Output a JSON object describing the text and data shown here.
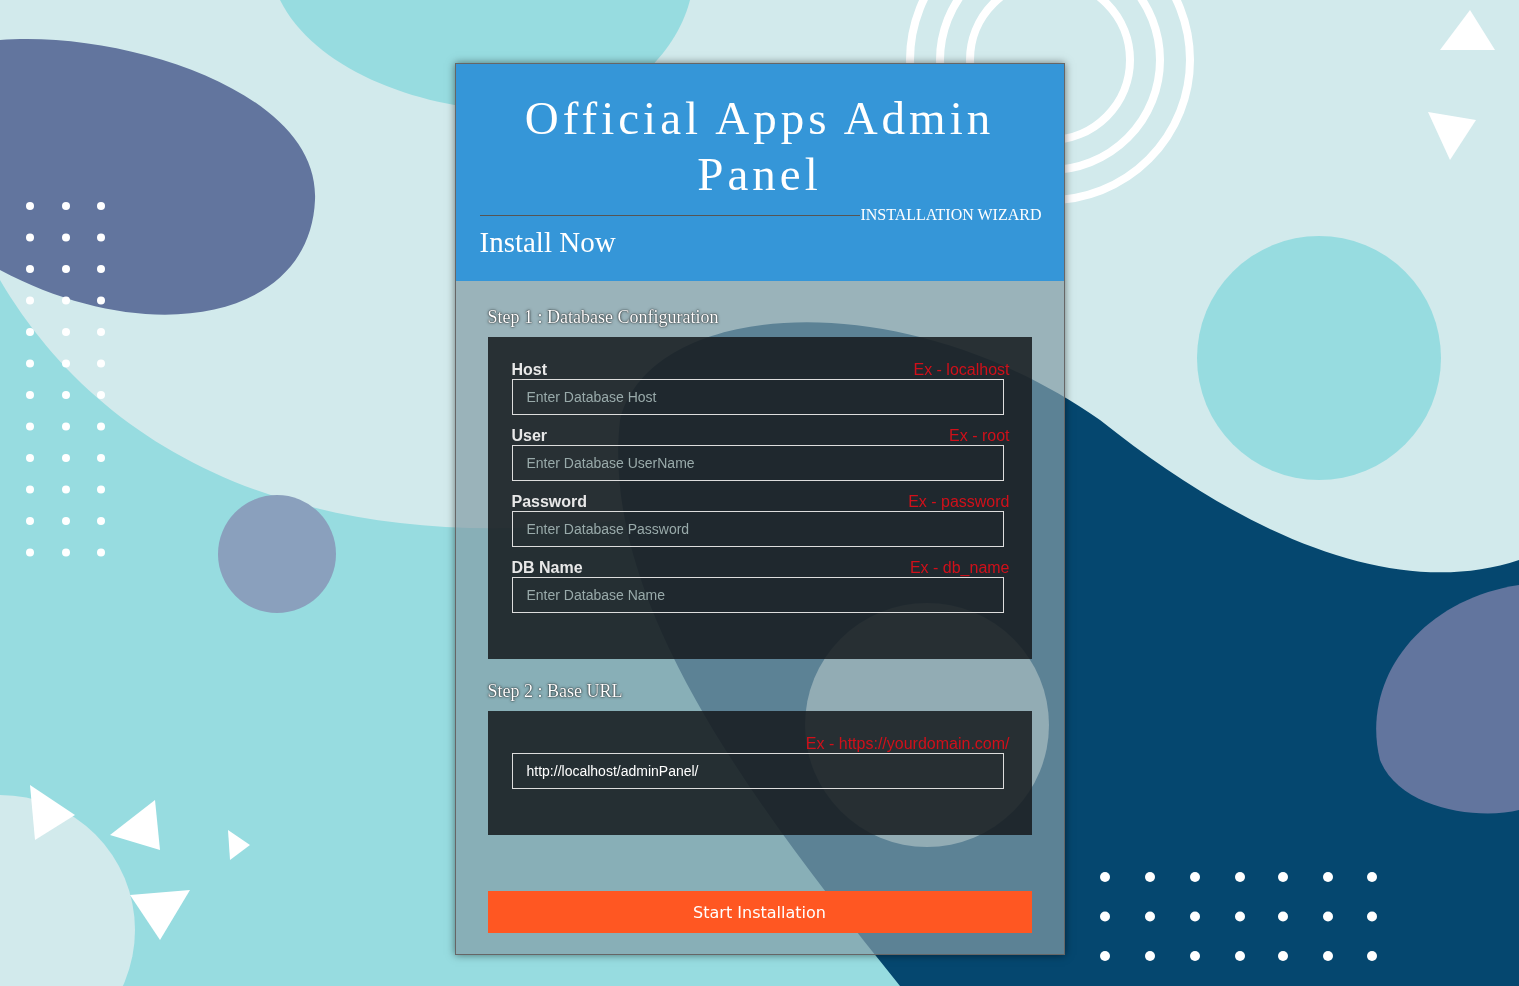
{
  "header": {
    "title": "Official Apps Admin Panel",
    "subtitle": "INSTALLATION WIZARD",
    "heading": "Install Now"
  },
  "steps": [
    {
      "title": "Step 1 : Database Configuration",
      "fields": [
        {
          "label": "Host",
          "example": "Ex - localhost",
          "placeholder": "Enter Database Host"
        },
        {
          "label": "User",
          "example": "Ex - root",
          "placeholder": "Enter Database UserName"
        },
        {
          "label": "Password",
          "example": "Ex - password",
          "placeholder": "Enter Database Password"
        },
        {
          "label": "DB Name",
          "example": "Ex - db_name",
          "placeholder": "Enter Database Name"
        }
      ]
    },
    {
      "title": "Step 2 : Base URL",
      "fields": [
        {
          "example": "Ex - https://yourdomain.com/",
          "value": "http://localhost/adminPanel/"
        }
      ]
    }
  ],
  "submit": "Start Installation"
}
